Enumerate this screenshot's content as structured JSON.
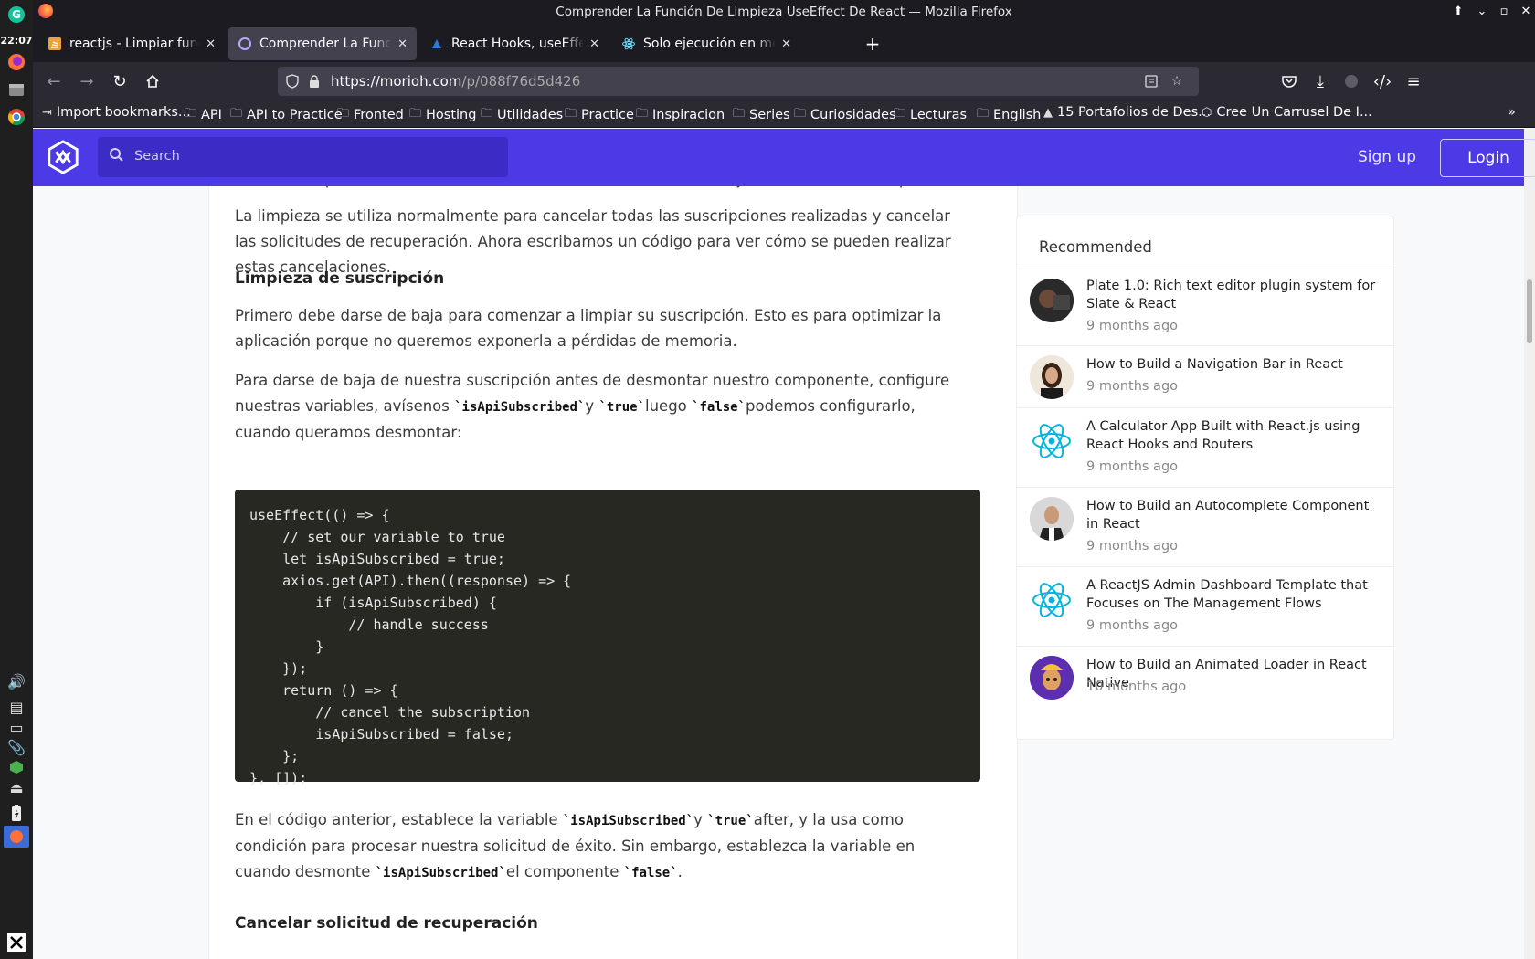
{
  "system": {
    "clock": "22:07"
  },
  "window": {
    "title": "Comprender La Función De Limpieza UseEffect De React — Mozilla Firefox"
  },
  "tabs": [
    {
      "label": "reactjs - Limpiar funcion al"
    },
    {
      "label": "Comprender La Función De"
    },
    {
      "label": "React Hooks, useEffect. Al"
    },
    {
      "label": "Solo ejecución en montaje"
    }
  ],
  "nav": {
    "url_domain": "https://morioh.com",
    "url_path": "/p/088f76d5d426"
  },
  "bookmarks": [
    {
      "label": "Import bookmarks..."
    },
    {
      "label": "API"
    },
    {
      "label": "API to Practice"
    },
    {
      "label": "Fronted"
    },
    {
      "label": "Hosting"
    },
    {
      "label": "Utilidades"
    },
    {
      "label": "Practice"
    },
    {
      "label": "Inspiracion"
    },
    {
      "label": "Series"
    },
    {
      "label": "Curiosidades"
    },
    {
      "label": "Lecturas"
    },
    {
      "label": "English"
    },
    {
      "label": "15 Portafolios de Des..."
    },
    {
      "label": "Cree Un Carrusel De I..."
    }
  ],
  "site": {
    "search_placeholder": "Search",
    "signup": "Sign up",
    "login": "Login",
    "brand_color": "#4b3ae6"
  },
  "article": {
    "cut_line": "también limpiamos los efectos del renderizado anterior antes de ejecutar los efectos la próxima vez\".",
    "p1": "La limpieza se utiliza normalmente para cancelar todas las suscripciones realizadas y cancelar las solicitudes de recuperación. Ahora escribamos un código para ver cómo se pueden realizar estas cancelaciones.",
    "h1": "Limpieza de suscripción",
    "p2": "Primero debe darse de baja para comenzar a limpiar su suscripción. Esto es para optimizar la aplicación porque no queremos exponerla a pérdidas de memoria.",
    "p3_a": "Para darse de baja de nuestra suscripción antes de desmontar nuestro componente, configure nuestras variables, avísenos ",
    "p3_code1": "`isApiSubscribed`",
    "p3_b": "y ",
    "p3_code2": "`true`",
    "p3_c": "luego ",
    "p3_code3": "`false`",
    "p3_d": "podemos configurarlo, cuando queramos desmontar:",
    "code": "useEffect(() => {\n    // set our variable to true\n    let isApiSubscribed = true;\n    axios.get(API).then((response) => {\n        if (isApiSubscribed) {\n            // handle success\n        }\n    });\n    return () => {\n        // cancel the subscription\n        isApiSubscribed = false;\n    };\n}, []);",
    "p4_a": "En el código anterior, establece la variable ",
    "p4_code1": "`isApiSubscribed`",
    "p4_b": "y ",
    "p4_code2": "`true`",
    "p4_c": "after, y la usa como condición para procesar nuestra solicitud de éxito. Sin embargo, establezca la variable en cuando desmonte ",
    "p4_code3": "`isApiSubscribed`",
    "p4_d": "el componente ",
    "p4_code4": "`false`",
    "p4_e": ".",
    "h2": "Cancelar solicitud de recuperación"
  },
  "recommended": {
    "title": "Recommended",
    "items": [
      {
        "title": "Plate 1.0: Rich text editor plugin system for Slate & React",
        "time": "9 months ago",
        "avatar": "portrait"
      },
      {
        "title": "How to Build a Navigation Bar in React",
        "time": "9 months ago",
        "avatar": "portrait"
      },
      {
        "title": "A Calculator App Built with React.js using React Hooks and Routers",
        "time": "9 months ago",
        "avatar": "react"
      },
      {
        "title": "How to Build an Autocomplete Component in React",
        "time": "9 months ago",
        "avatar": "portrait"
      },
      {
        "title": "A ReactJS Admin Dashboard Template that Focuses on The Management Flows",
        "time": "9 months ago",
        "avatar": "react"
      },
      {
        "title": "How to Build an Animated Loader in React Native",
        "time": "10 months ago",
        "avatar": "portrait"
      }
    ]
  }
}
